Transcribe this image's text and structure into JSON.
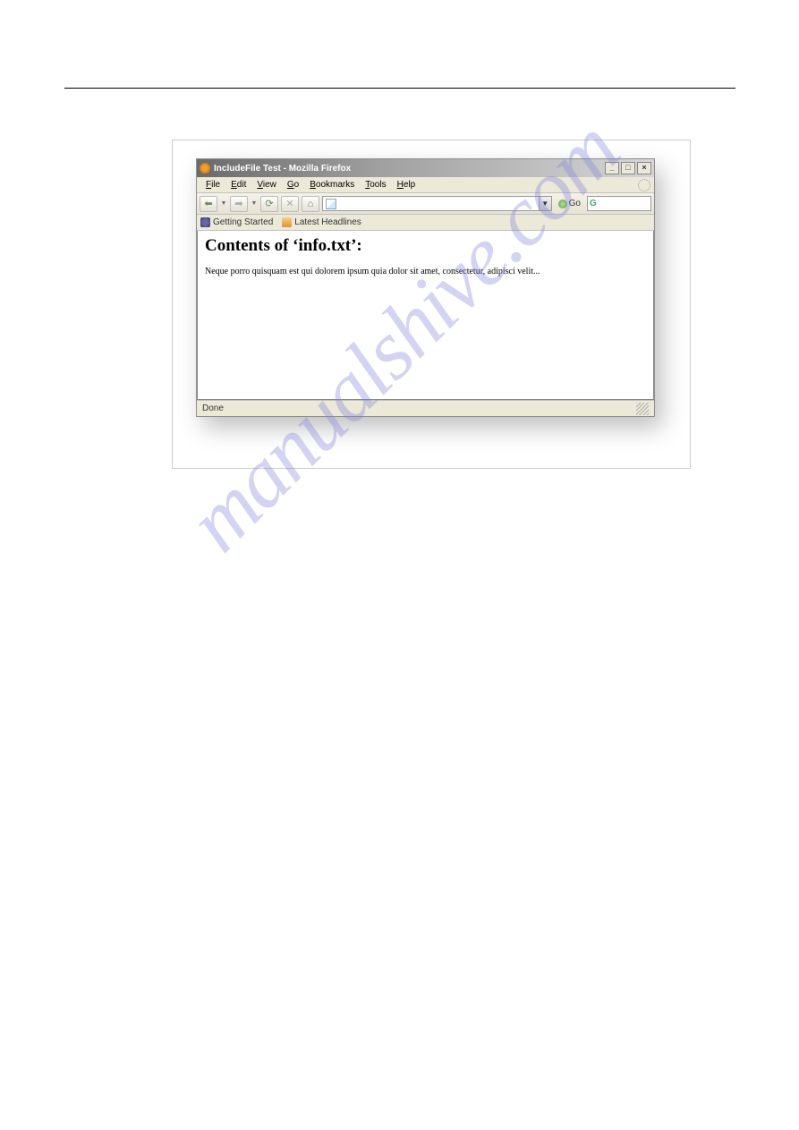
{
  "watermark": "manualshive.com",
  "browser": {
    "title": "IncludeFile Test - Mozilla Firefox",
    "menu": {
      "file": "File",
      "edit": "Edit",
      "view": "View",
      "go": "Go",
      "bookmarks": "Bookmarks",
      "tools": "Tools",
      "help": "Help"
    },
    "go_label": "Go",
    "bookmarks_bar": {
      "getting_started": "Getting Started",
      "latest_headlines": "Latest Headlines"
    },
    "content": {
      "heading": "Contents of ‘info.txt’:",
      "body": "Neque porro quisquam est qui dolorem ipsum quia dolor sit amet, consectetur, adipisci velit..."
    },
    "status": "Done",
    "window_controls": {
      "minimize": "_",
      "maximize": "□",
      "close": "×"
    }
  }
}
